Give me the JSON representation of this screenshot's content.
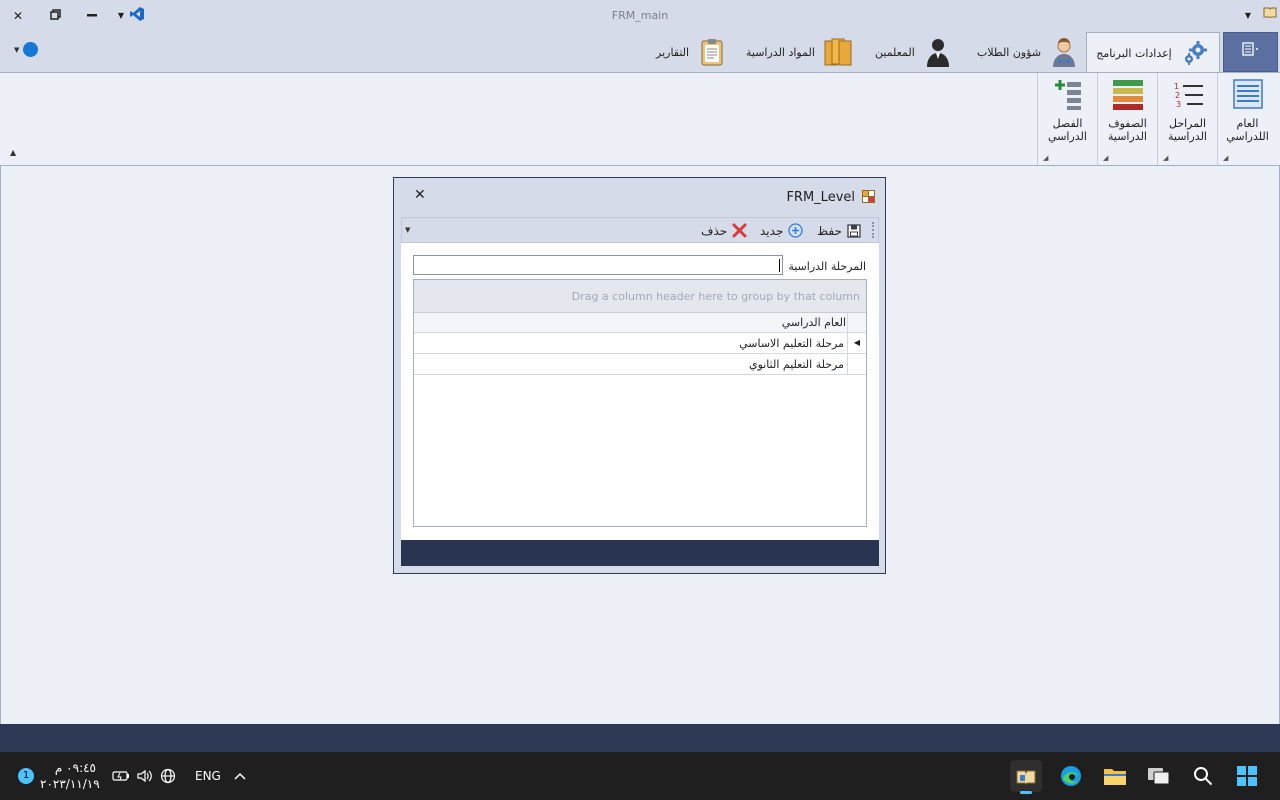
{
  "window": {
    "title": "FRM_main"
  },
  "ribbon": {
    "tabs": [
      {
        "id": "settings",
        "label": "إعدادات البرنامج",
        "icon": "gear-icon",
        "active": true
      },
      {
        "id": "students",
        "label": "شؤون الطلاب",
        "icon": "student-icon"
      },
      {
        "id": "teachers",
        "label": "المعلمين",
        "icon": "teacher-icon"
      },
      {
        "id": "subjects",
        "label": "المواد الدراسية",
        "icon": "books-icon"
      },
      {
        "id": "reports",
        "label": "التقارير",
        "icon": "clipboard-icon"
      }
    ],
    "groups": [
      {
        "id": "academic-year",
        "label_1": "العام",
        "label_2": "اللدراسي",
        "icon": "calendar-list-icon"
      },
      {
        "id": "levels",
        "label_1": "المراحل",
        "label_2": "الدراسية",
        "icon": "numbered-list-icon"
      },
      {
        "id": "grades",
        "label_1": "الصفوف",
        "label_2": "الدراسية",
        "icon": "colored-rows-icon"
      },
      {
        "id": "class",
        "label_1": "الفصل",
        "label_2": "الدراسي",
        "icon": "add-list-icon"
      }
    ]
  },
  "dialog": {
    "title": "FRM_Level",
    "toolbar": {
      "save_label": "حفظ",
      "new_label": "جديد",
      "delete_label": "حذف"
    },
    "form": {
      "level_label": "المرحلة الدراسية",
      "level_value": ""
    },
    "grid": {
      "group_hint": "Drag a column header here to group by that column",
      "column_header": "العام الدراسي",
      "rows": [
        {
          "value": "مرحلة التعليم الاساسي",
          "selected": true
        },
        {
          "value": "مرحلة التعليم الثانوي",
          "selected": false
        }
      ]
    }
  },
  "taskbar": {
    "time": "٠٩:٤٥ م",
    "date": "٢٠٢٣/١١/١٩",
    "language": "ENG",
    "notification_count": "1"
  },
  "colors": {
    "accent": "#1478d4",
    "file_tab": "#5b6fa0",
    "status_bar": "#2e3a55",
    "taskbar": "#1f1f1f"
  }
}
